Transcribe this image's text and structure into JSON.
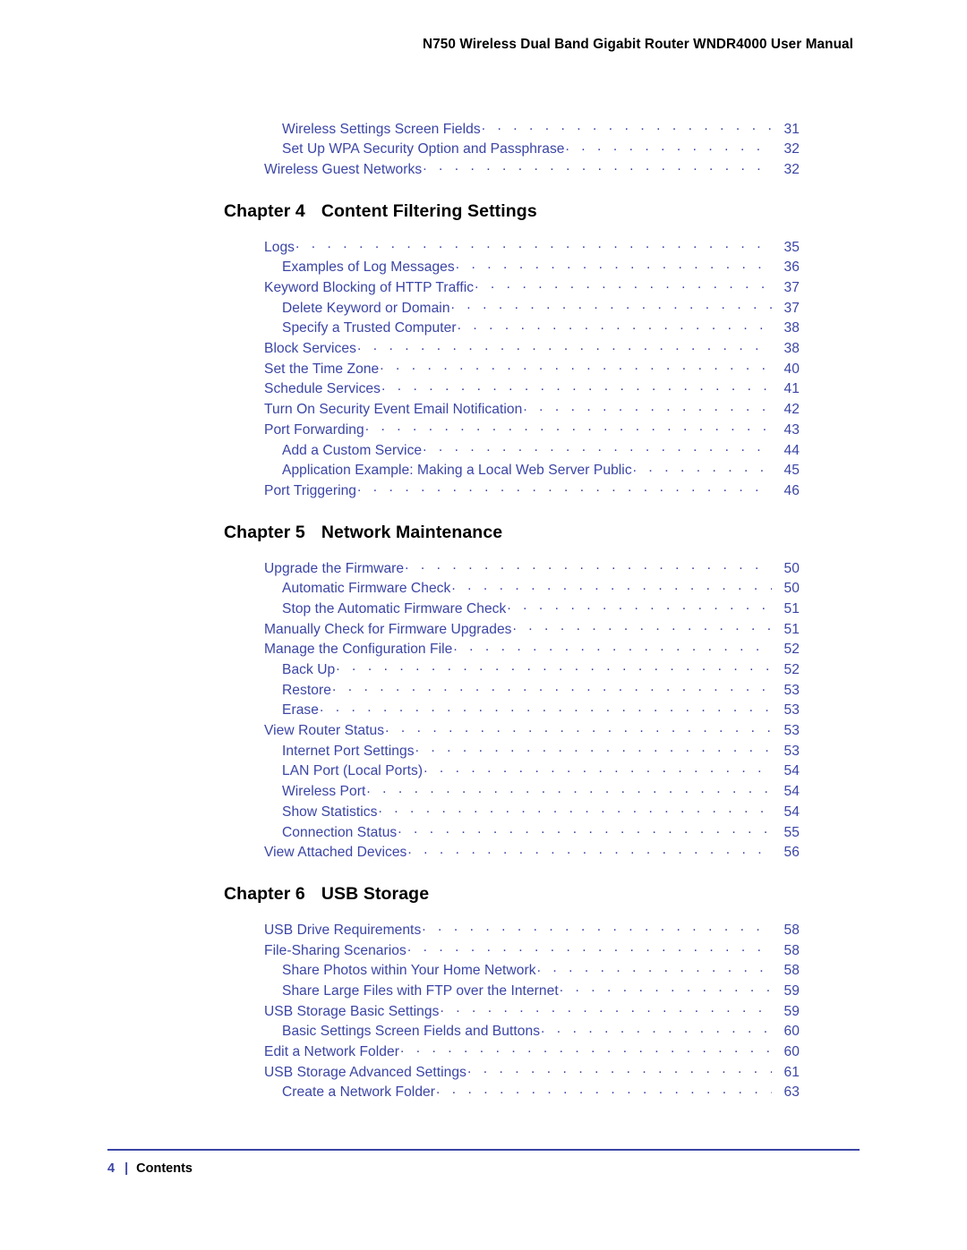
{
  "header": {
    "title": "N750 Wireless Dual Band Gigabit Router WNDR4000 User Manual"
  },
  "colors": {
    "toc_text": "#3b45a5",
    "heading_text": "#000000",
    "rule": "#3b45a5"
  },
  "toc": {
    "leading_entries": [
      {
        "level": 2,
        "title": "Wireless Settings Screen Fields",
        "page": "31"
      },
      {
        "level": 2,
        "title": "Set Up WPA Security Option and Passphrase",
        "page": "32"
      },
      {
        "level": 1,
        "title": "Wireless Guest Networks",
        "page": "32"
      }
    ],
    "chapters": [
      {
        "number_label": "Chapter 4",
        "title": "Content Filtering Settings",
        "entries": [
          {
            "level": 1,
            "title": "Logs",
            "page": "35"
          },
          {
            "level": 2,
            "title": "Examples of Log Messages",
            "page": "36"
          },
          {
            "level": 1,
            "title": "Keyword Blocking of HTTP Traffic",
            "page": "37"
          },
          {
            "level": 2,
            "title": "Delete Keyword or Domain",
            "page": "37"
          },
          {
            "level": 2,
            "title": "Specify a Trusted Computer",
            "page": "38"
          },
          {
            "level": 1,
            "title": "Block Services",
            "page": "38"
          },
          {
            "level": 1,
            "title": "Set the Time Zone",
            "page": "40"
          },
          {
            "level": 1,
            "title": "Schedule Services",
            "page": "41"
          },
          {
            "level": 1,
            "title": "Turn On Security Event Email Notification",
            "page": "42"
          },
          {
            "level": 1,
            "title": "Port Forwarding",
            "page": "43"
          },
          {
            "level": 2,
            "title": "Add a Custom Service",
            "page": "44"
          },
          {
            "level": 2,
            "title": "Application Example: Making a Local Web Server Public",
            "page": "45"
          },
          {
            "level": 1,
            "title": "Port Triggering",
            "page": "46"
          }
        ]
      },
      {
        "number_label": "Chapter 5",
        "title": "Network Maintenance",
        "entries": [
          {
            "level": 1,
            "title": "Upgrade the Firmware",
            "page": "50"
          },
          {
            "level": 2,
            "title": "Automatic Firmware Check",
            "page": "50"
          },
          {
            "level": 2,
            "title": "Stop the Automatic Firmware Check",
            "page": "51"
          },
          {
            "level": 1,
            "title": "Manually Check for Firmware Upgrades",
            "page": "51"
          },
          {
            "level": 1,
            "title": "Manage the Configuration File",
            "page": "52"
          },
          {
            "level": 2,
            "title": "Back Up",
            "page": "52"
          },
          {
            "level": 2,
            "title": "Restore",
            "page": "53"
          },
          {
            "level": 2,
            "title": "Erase",
            "page": "53"
          },
          {
            "level": 1,
            "title": "View Router Status",
            "page": "53"
          },
          {
            "level": 2,
            "title": "Internet Port Settings",
            "page": "53"
          },
          {
            "level": 2,
            "title": "LAN Port (Local Ports)",
            "page": "54"
          },
          {
            "level": 2,
            "title": "Wireless Port",
            "page": "54"
          },
          {
            "level": 2,
            "title": "Show Statistics",
            "page": "54"
          },
          {
            "level": 2,
            "title": "Connection Status",
            "page": "55"
          },
          {
            "level": 1,
            "title": "View Attached Devices",
            "page": "56"
          }
        ]
      },
      {
        "number_label": "Chapter 6",
        "title": "USB Storage",
        "entries": [
          {
            "level": 1,
            "title": "USB Drive Requirements",
            "page": "58"
          },
          {
            "level": 1,
            "title": "File-Sharing Scenarios",
            "page": "58"
          },
          {
            "level": 2,
            "title": "Share Photos within Your Home Network",
            "page": "58"
          },
          {
            "level": 2,
            "title": "Share Large Files with FTP over the Internet",
            "page": "59"
          },
          {
            "level": 1,
            "title": "USB Storage Basic Settings",
            "page": "59"
          },
          {
            "level": 2,
            "title": "Basic Settings Screen Fields and Buttons",
            "page": "60"
          },
          {
            "level": 1,
            "title": "Edit a Network Folder",
            "page": "60"
          },
          {
            "level": 1,
            "title": "USB Storage Advanced Settings",
            "page": "61"
          },
          {
            "level": 2,
            "title": "Create a Network Folder",
            "page": "63"
          }
        ]
      }
    ]
  },
  "footer": {
    "page_number": "4",
    "separator": "|",
    "section_label": "Contents"
  }
}
